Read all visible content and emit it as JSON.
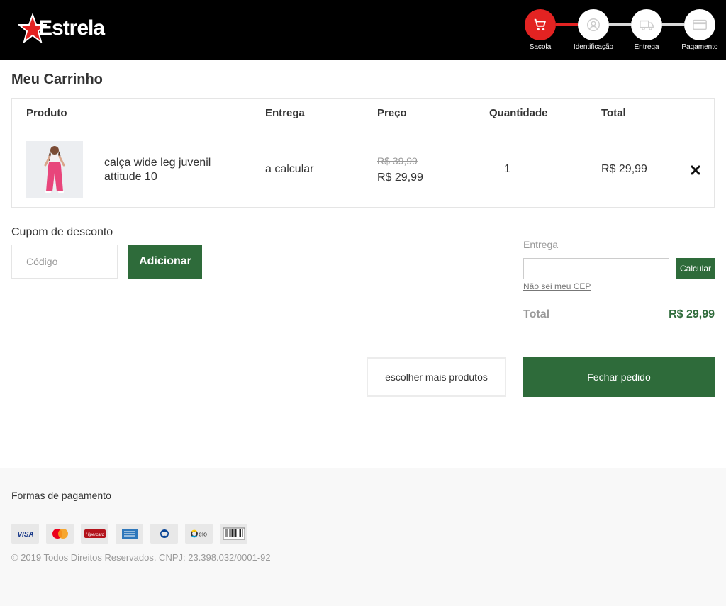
{
  "header": {
    "logo_text": "Estrela",
    "steps": [
      {
        "label": "Sacola",
        "icon": "cart-icon",
        "active": true
      },
      {
        "label": "Identificação",
        "icon": "user-icon",
        "active": false
      },
      {
        "label": "Entrega",
        "icon": "truck-icon",
        "active": false
      },
      {
        "label": "Pagamento",
        "icon": "card-icon",
        "active": false
      }
    ]
  },
  "page_title": "Meu Carrinho",
  "table": {
    "headers": {
      "product": "Produto",
      "delivery": "Entrega",
      "price": "Preço",
      "quantity": "Quantidade",
      "total": "Total"
    },
    "items": [
      {
        "name": "calça wide leg juvenil attitude 10",
        "delivery": "a calcular",
        "old_price": "R$ 39,99",
        "price": "R$ 29,99",
        "quantity": "1",
        "total": "R$ 29,99"
      }
    ]
  },
  "coupon": {
    "label": "Cupom de desconto",
    "placeholder": "Código",
    "button": "Adicionar"
  },
  "shipping": {
    "label": "Entrega",
    "button": "Calcular",
    "link": "Não sei meu CEP"
  },
  "summary": {
    "total_label": "Total",
    "total_value": "R$ 29,99"
  },
  "actions": {
    "more_products": "escolher mais produtos",
    "checkout": "Fechar pedido"
  },
  "footer": {
    "payment_title": "Formas de pagamento",
    "payment_methods": [
      "visa",
      "mastercard",
      "hipercard",
      "amex",
      "diners",
      "elo",
      "boleto"
    ],
    "copyright": "© 2019 Todos Direitos Reservados. CNPJ: 23.398.032/0001-92"
  },
  "colors": {
    "brand_red": "#e32322",
    "brand_green": "#2e6b3a",
    "header_bg": "#000000"
  }
}
